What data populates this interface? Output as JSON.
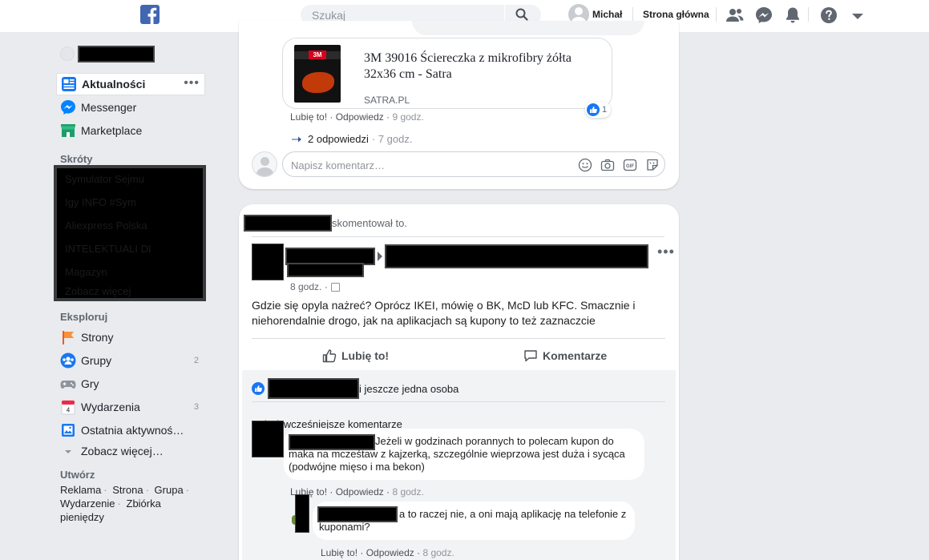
{
  "topbar": {
    "search_placeholder": "Szukaj",
    "user_name": "Michał",
    "home_label": "Strona główna"
  },
  "sidebar": {
    "items": [
      {
        "label": "Aktualności",
        "icon": "news-feed-icon",
        "more": "•••"
      },
      {
        "label": "Messenger",
        "icon": "messenger-icon"
      },
      {
        "label": "Marketplace",
        "icon": "marketplace-icon"
      }
    ],
    "shortcuts_heading": "Skróty",
    "shortcuts": [
      "Symulator Sejmu",
      "Igy INFO #Sym",
      "Aliexpress Polska",
      "INTELEKTUALI DI",
      "Magazyn",
      "Zobacz więcej"
    ],
    "explore_heading": "Eksploruj",
    "explore": [
      {
        "label": "Strony",
        "icon": "pages-flag-icon",
        "count": ""
      },
      {
        "label": "Grupy",
        "icon": "groups-icon",
        "count": "2"
      },
      {
        "label": "Gry",
        "icon": "gamepad-icon",
        "count": ""
      },
      {
        "label": "Wydarzenia",
        "icon": "calendar-icon",
        "count": "3"
      },
      {
        "label": "Ostatnia aktywnoś…",
        "icon": "activity-log-icon",
        "count": ""
      },
      {
        "label": "Zobacz więcej…",
        "icon": "chevron-down-icon",
        "count": ""
      }
    ],
    "create_heading": "Utwórz",
    "create_links": [
      "Reklama",
      "Strona",
      "Grupa",
      "Wydarzenie",
      "Zbiórka pieniędzy"
    ]
  },
  "card1": {
    "link_title": "3M 39016 Ściereczka z mikrofibry żółta 32x36 cm - Satra",
    "link_domain": "SATRA.PL",
    "thumb_logo": "3M",
    "likes_count": "1",
    "like_label": "Lubię to!",
    "reply_label": "Odpowiedz",
    "time": "9 godz.",
    "replies_label": "2 odpowiedzi",
    "replies_time": "7 godz.",
    "comment_placeholder": "Napisz komentarz…"
  },
  "card2": {
    "activity_text": "skomentował to.",
    "post_time": "8 godz.",
    "post_text": "Gdzie się opyla nażreć? Oprócz IKEI, mówię o BK, McD lub KFC. Smacznie i niehorendalnie drogo, jak na aplikacjach są kupony to też zaznaczcie",
    "like_button": "Lubię to!",
    "comment_button": "Komentarze",
    "likes_text": "i jeszcze jedna osoba",
    "show_previous": "Pokaż wcześniejsze komentarze",
    "comments": [
      {
        "text": "Jeżeli w godzinach porannych to polecam kupon do maka na mcześtaw z kajzerką, szczególnie wieprzowa jest duża i sycąca (podwójne mięso i ma bekon)",
        "like": "Lubię to!",
        "reply": "Odpowiedz",
        "time": "8 godz."
      },
      {
        "text": "a to raczej nie, a oni mają aplikację na telefonie z kuponami?",
        "like": "Lubię to!",
        "reply": "Odpowiedz",
        "time": "8 godz."
      }
    ]
  },
  "colors": {
    "brand": "#1877f2",
    "link": "#385898",
    "background": "#e9ebee"
  }
}
